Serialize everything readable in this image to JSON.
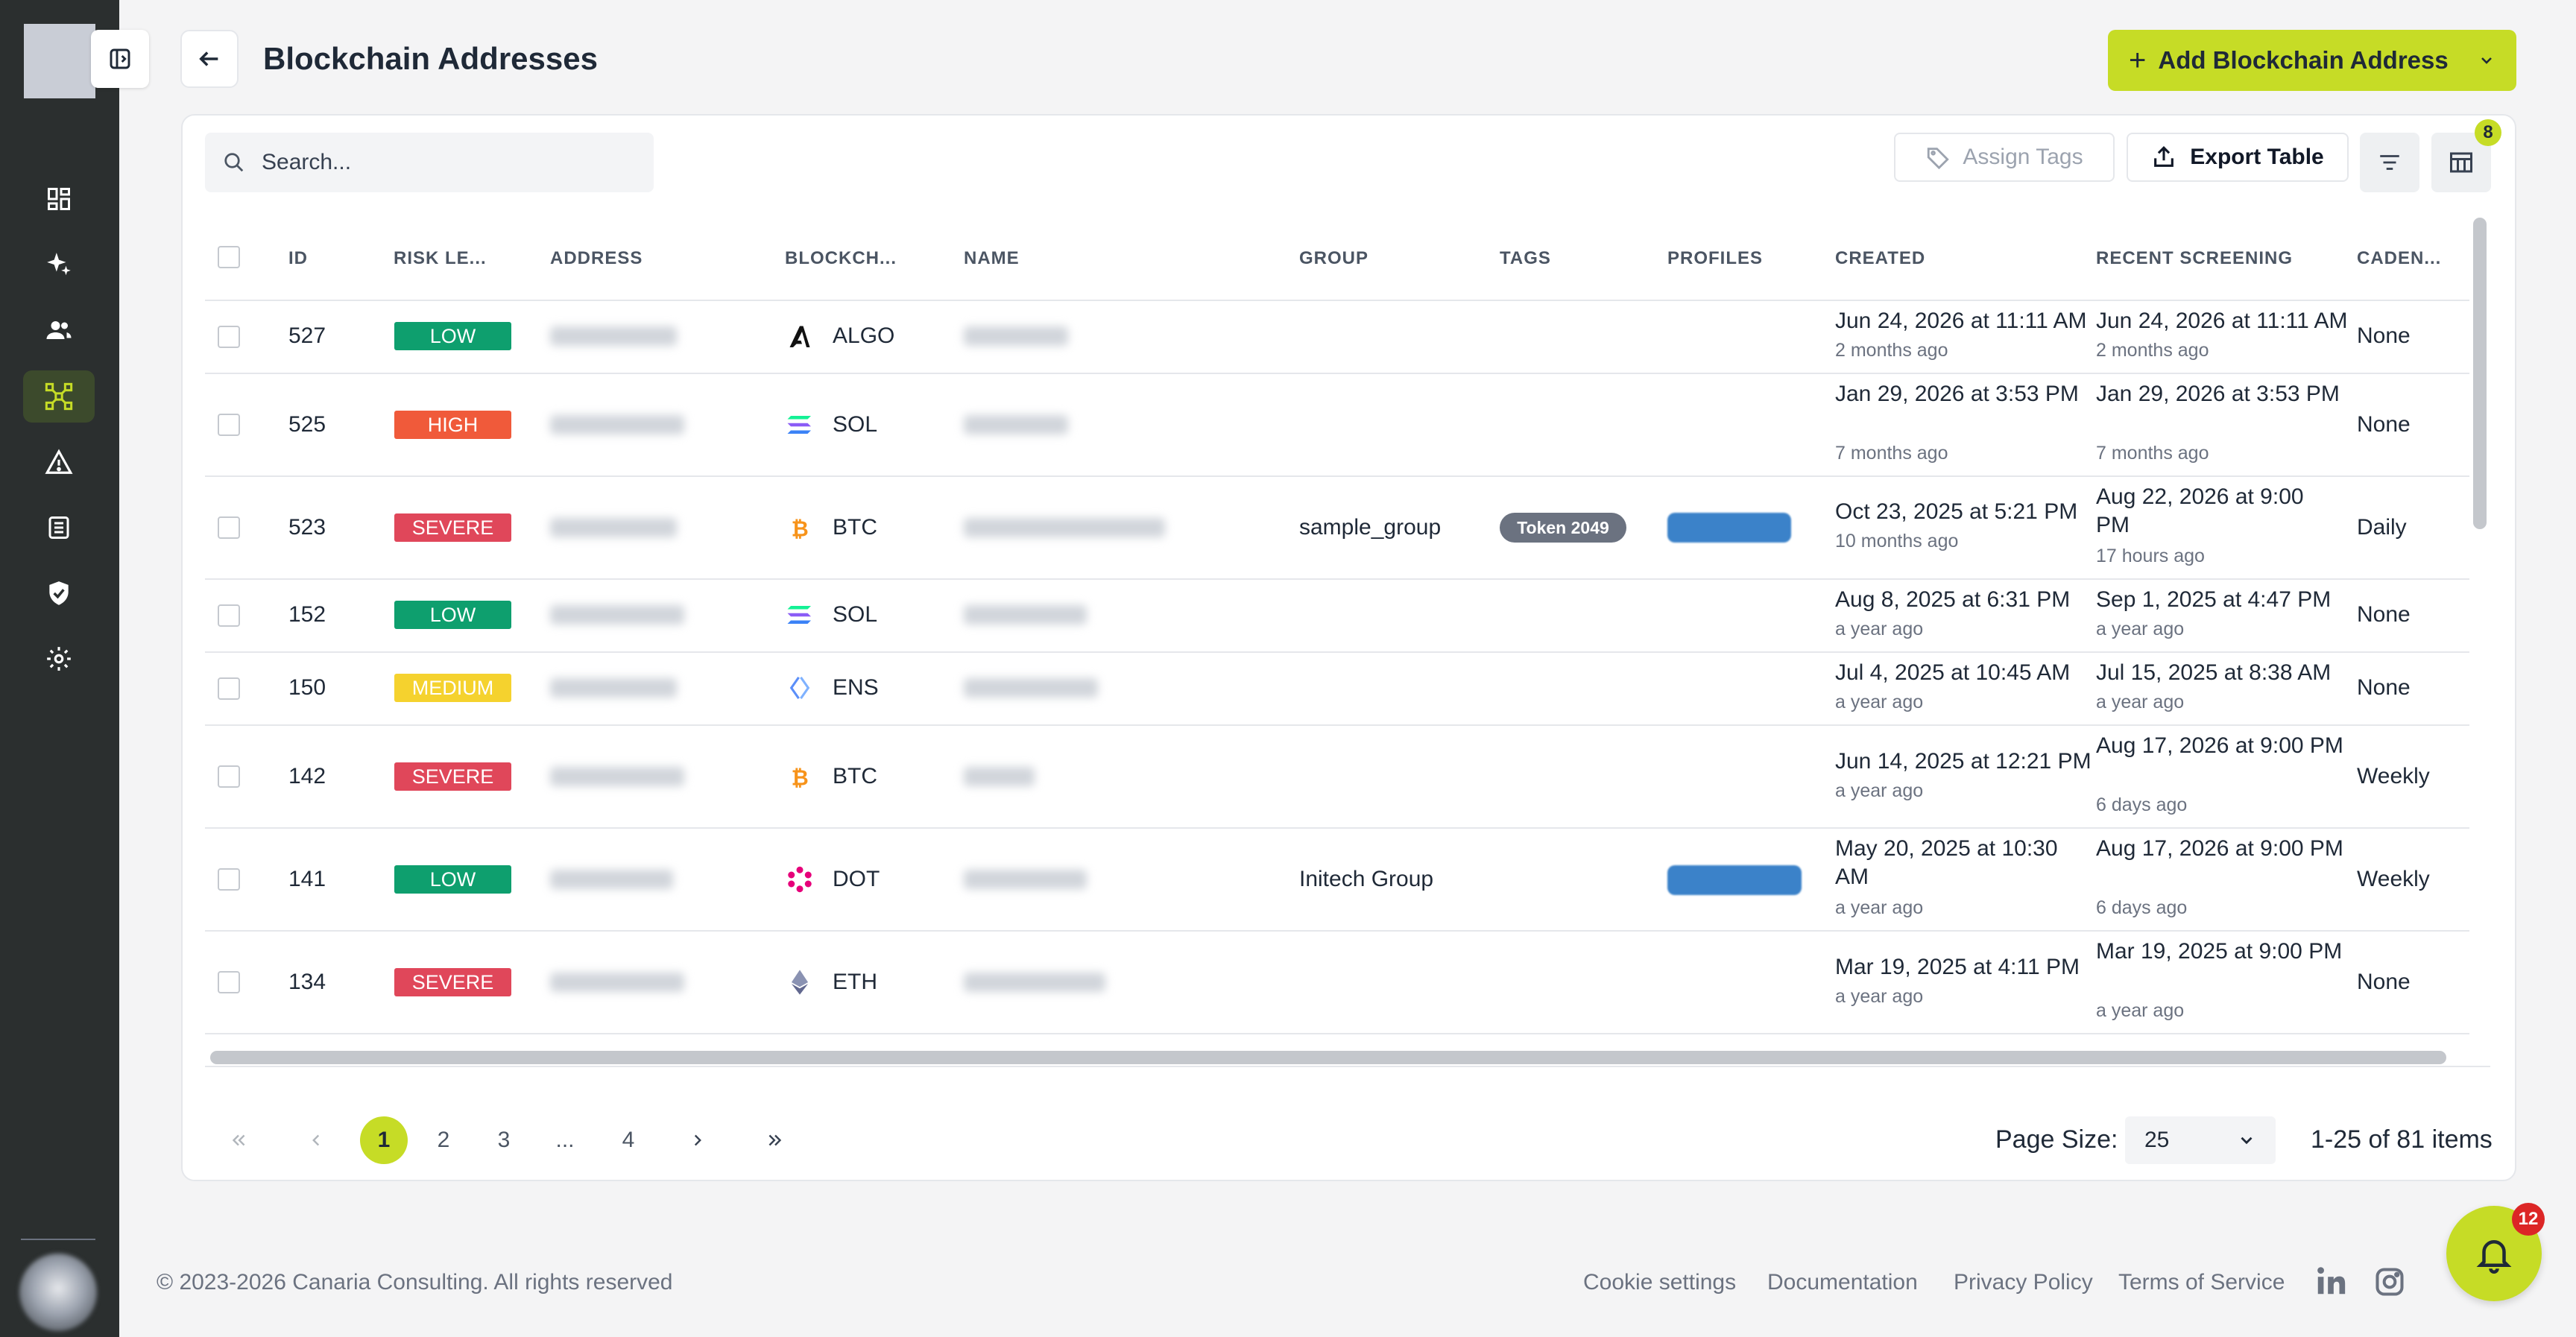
{
  "header": {
    "title": "Blockchain Addresses",
    "add_button_label": "Add Blockchain Address"
  },
  "toolbar": {
    "search_placeholder": "Search...",
    "assign_tags_label": "Assign Tags",
    "export_label": "Export Table",
    "columns_badge": "8"
  },
  "table": {
    "columns": [
      "ID",
      "RISK LE...",
      "ADDRESS",
      "BLOCKCH...",
      "NAME",
      "GROUP",
      "TAGS",
      "PROFILES",
      "CREATED",
      "RECENT SCREENING",
      "CADEN..."
    ],
    "rows": [
      {
        "id": "527",
        "risk": "LOW",
        "chain": "ALGO",
        "group": "",
        "tag": "",
        "created": "Jun 24, 2026 at 11:11 AM",
        "created_rel": "2 months ago",
        "screening": "Jun 24, 2026 at 11:11 AM",
        "screening_rel": "2 months ago",
        "cadence": "None"
      },
      {
        "id": "525",
        "risk": "HIGH",
        "chain": "SOL",
        "group": "",
        "tag": "",
        "created": "Jan 29, 2026 at 3:53 PM",
        "created_rel": "7 months ago",
        "screening": "Jan 29, 2026 at 3:53 PM",
        "screening_rel": "7 months ago",
        "cadence": "None"
      },
      {
        "id": "523",
        "risk": "SEVERE",
        "chain": "BTC",
        "group": "sample_group",
        "tag": "Token 2049",
        "created": "Oct 23, 2025 at 5:21 PM",
        "created_rel": "10 months ago",
        "screening": "Aug 22, 2026 at 9:00 PM",
        "screening_rel": "17 hours ago",
        "cadence": "Daily"
      },
      {
        "id": "152",
        "risk": "LOW",
        "chain": "SOL",
        "group": "",
        "tag": "",
        "created": "Aug 8, 2025 at 6:31 PM",
        "created_rel": "a year ago",
        "screening": "Sep 1, 2025 at 4:47 PM",
        "screening_rel": "a year ago",
        "cadence": "None"
      },
      {
        "id": "150",
        "risk": "MEDIUM",
        "chain": "ENS",
        "group": "",
        "tag": "",
        "created": "Jul 4, 2025 at 10:45 AM",
        "created_rel": "a year ago",
        "screening": "Jul 15, 2025 at 8:38 AM",
        "screening_rel": "a year ago",
        "cadence": "None"
      },
      {
        "id": "142",
        "risk": "SEVERE",
        "chain": "BTC",
        "group": "",
        "tag": "",
        "created": "Jun 14, 2025 at 12:21 PM",
        "created_rel": "a year ago",
        "screening": "Aug 17, 2026 at 9:00 PM",
        "screening_rel": "6 days ago",
        "cadence": "Weekly"
      },
      {
        "id": "141",
        "risk": "LOW",
        "chain": "DOT",
        "group": "Initech Group",
        "tag": "",
        "created": "May 20, 2025 at 10:30 AM",
        "created_rel": "a year ago",
        "screening": "Aug 17, 2026 at 9:00 PM",
        "screening_rel": "6 days ago",
        "cadence": "Weekly"
      },
      {
        "id": "134",
        "risk": "SEVERE",
        "chain": "ETH",
        "group": "",
        "tag": "",
        "created": "Mar 19, 2025 at 4:11 PM",
        "created_rel": "a year ago",
        "screening": "Mar 19, 2025 at 9:00 PM",
        "screening_rel": "a year ago",
        "cadence": "None"
      }
    ]
  },
  "risk_colors": {
    "LOW": "#0e9f6e",
    "HIGH": "#f05a3a",
    "SEVERE": "#e0475a",
    "MEDIUM": "#f5d22e"
  },
  "pagination": {
    "pages": [
      "1",
      "2",
      "3",
      "...",
      "4"
    ],
    "page_size_label": "Page Size:",
    "page_size": "25",
    "items_summary": "1-25 of 81 items"
  },
  "footer": {
    "copyright": "© 2023-2026 Canaria Consulting. All rights reserved",
    "links": [
      "Cookie settings",
      "Documentation",
      "Privacy Policy",
      "Terms of Service"
    ]
  },
  "notifications": {
    "count": "12"
  },
  "accent_color": "#c6dc26"
}
